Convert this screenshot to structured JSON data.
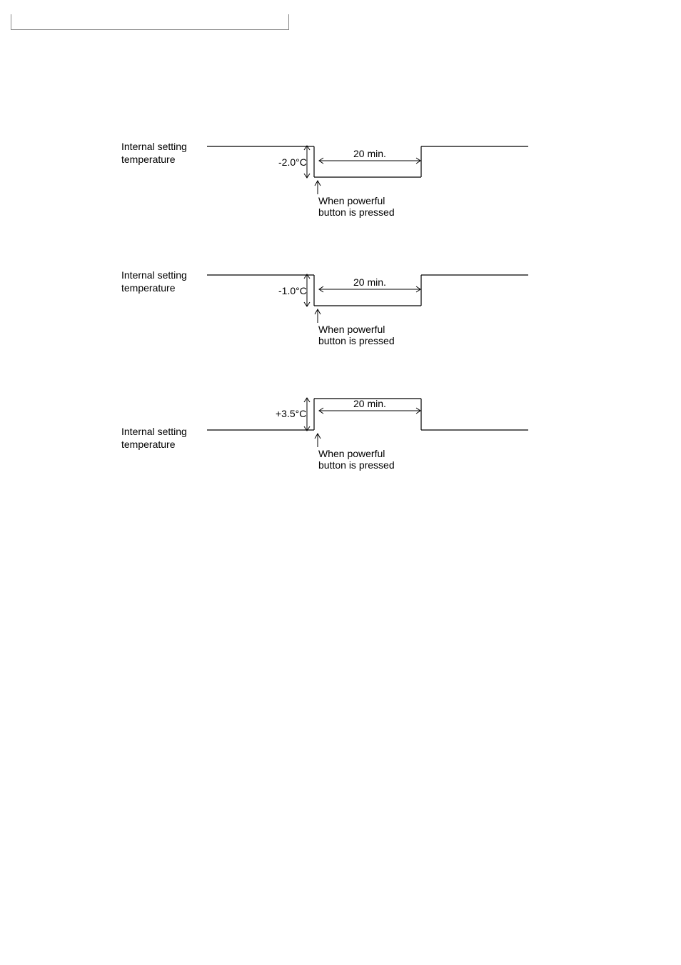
{
  "chart_data": [
    {
      "type": "line",
      "label": "Internal setting temperature",
      "offset_deg_c": -2.0,
      "offset_text": "-2.0°C",
      "duration_min": 20,
      "duration_text": "20 min.",
      "event_text": "When powerful button is pressed",
      "direction": "down"
    },
    {
      "type": "line",
      "label": "Internal setting temperature",
      "offset_deg_c": -1.0,
      "offset_text": "-1.0°C",
      "duration_min": 20,
      "duration_text": "20 min.",
      "event_text": "When powerful button is pressed",
      "direction": "down"
    },
    {
      "type": "line",
      "label": "Internal setting temperature",
      "offset_deg_c": 3.5,
      "offset_text": "+3.5°C",
      "duration_min": 20,
      "duration_text": "20 min.",
      "event_text": "When powerful button is pressed",
      "direction": "up"
    }
  ]
}
